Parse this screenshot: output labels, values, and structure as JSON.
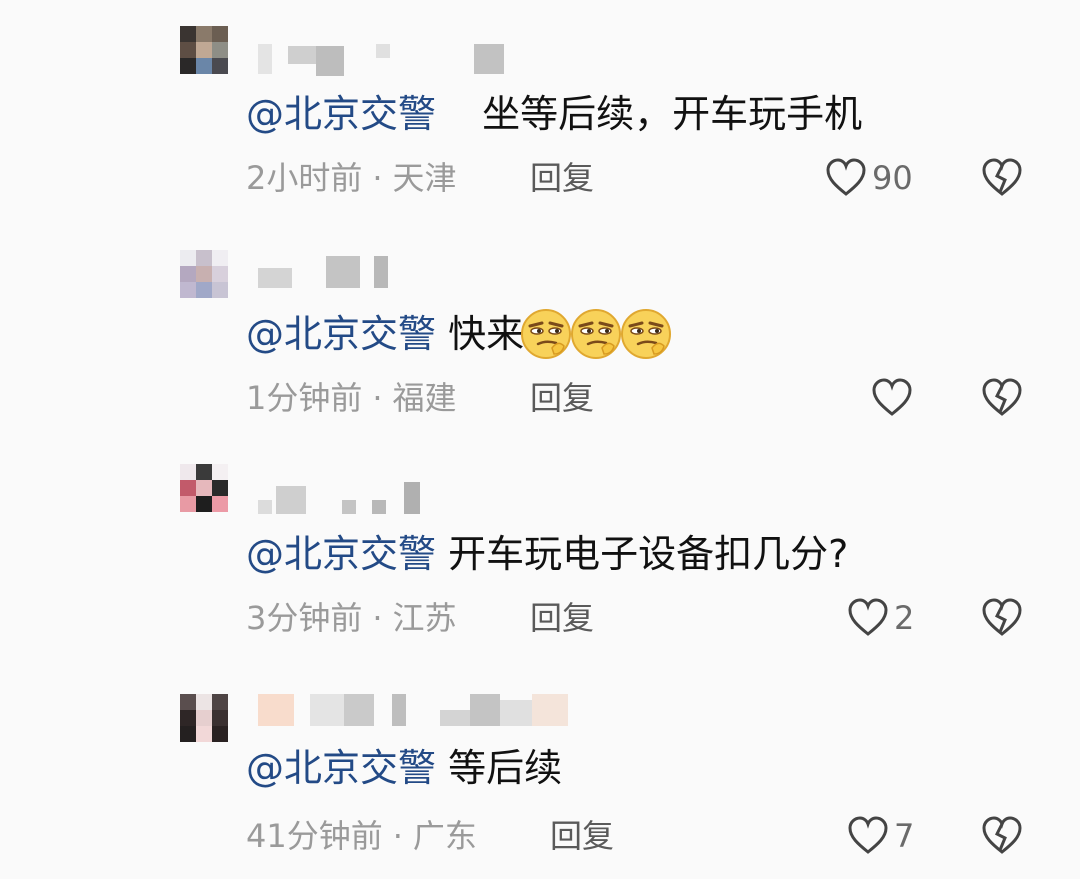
{
  "comments": [
    {
      "mention": "@北京交警",
      "text": "坐等后续，开车玩手机",
      "time": "2小时前",
      "location": "天津",
      "reply_label": "回复",
      "like_count": "90",
      "emoji_count": 0
    },
    {
      "mention": "@北京交警",
      "text": "快来",
      "time": "1分钟前",
      "location": "福建",
      "reply_label": "回复",
      "like_count": "",
      "emoji_count": 3
    },
    {
      "mention": "@北京交警",
      "text": "开车玩电子设备扣几分?",
      "time": "3分钟前",
      "location": "江苏",
      "reply_label": "回复",
      "like_count": "2",
      "emoji_count": 0
    },
    {
      "mention": "@北京交警",
      "text": "等后续",
      "time": "41分钟前",
      "location": "广东",
      "reply_label": "回复",
      "like_count": "7",
      "emoji_count": 0
    }
  ],
  "separator": "·",
  "icons": {
    "like": "heart-outline-icon",
    "dislike": "broken-heart-icon",
    "emoji": "smirk-emoji-icon"
  },
  "colors": {
    "mention": "#234a86",
    "meta": "#9a9a9a",
    "background": "#fafafa"
  }
}
